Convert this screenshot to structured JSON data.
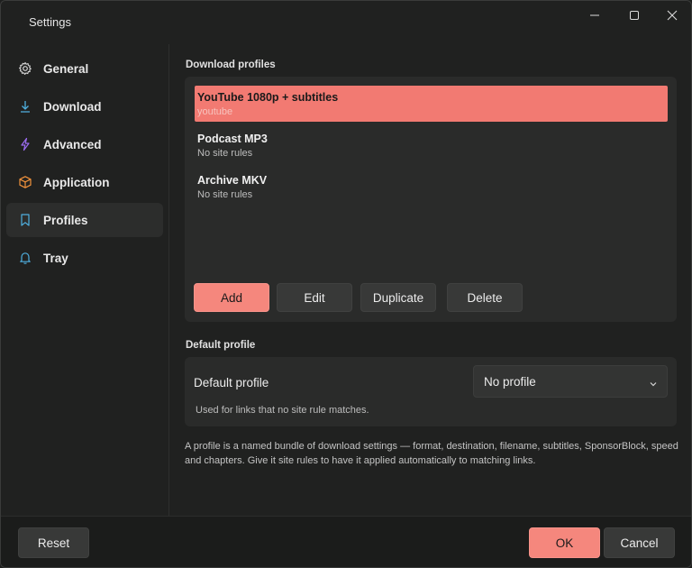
{
  "window": {
    "title": "Settings"
  },
  "sidebar": {
    "items": [
      {
        "label": "General",
        "icon": "gear-icon"
      },
      {
        "label": "Download",
        "icon": "download-icon"
      },
      {
        "label": "Advanced",
        "icon": "lightning-icon"
      },
      {
        "label": "Application",
        "icon": "box-icon"
      },
      {
        "label": "Profiles",
        "icon": "bookmark-icon",
        "active": true
      },
      {
        "label": "Tray",
        "icon": "bell-icon"
      }
    ]
  },
  "profiles": {
    "section_label": "Download profiles",
    "list": [
      {
        "name": "YouTube 1080p + subtitles",
        "sub": "youtube",
        "selected": true
      },
      {
        "name": "Podcast MP3",
        "sub": "No site rules"
      },
      {
        "name": "Archive MKV",
        "sub": "No site rules"
      }
    ],
    "buttons": {
      "add": "Add",
      "edit": "Edit",
      "duplicate": "Duplicate",
      "delete": "Delete"
    }
  },
  "default_profile": {
    "section_label": "Default profile",
    "label": "Default profile",
    "selected": "No profile",
    "note": "Used for links that no site rule matches."
  },
  "description": "A profile is a named bundle of download settings — format, destination, filename, subtitles, SponsorBlock, speed and chapters. Give it site rules to have it applied automatically to matching links.",
  "footer": {
    "reset": "Reset",
    "ok": "OK",
    "cancel": "Cancel"
  },
  "colors": {
    "accent": "#f5877d",
    "selected_row": "#f27a72",
    "background": "#202120",
    "card": "#2a2b2a"
  }
}
